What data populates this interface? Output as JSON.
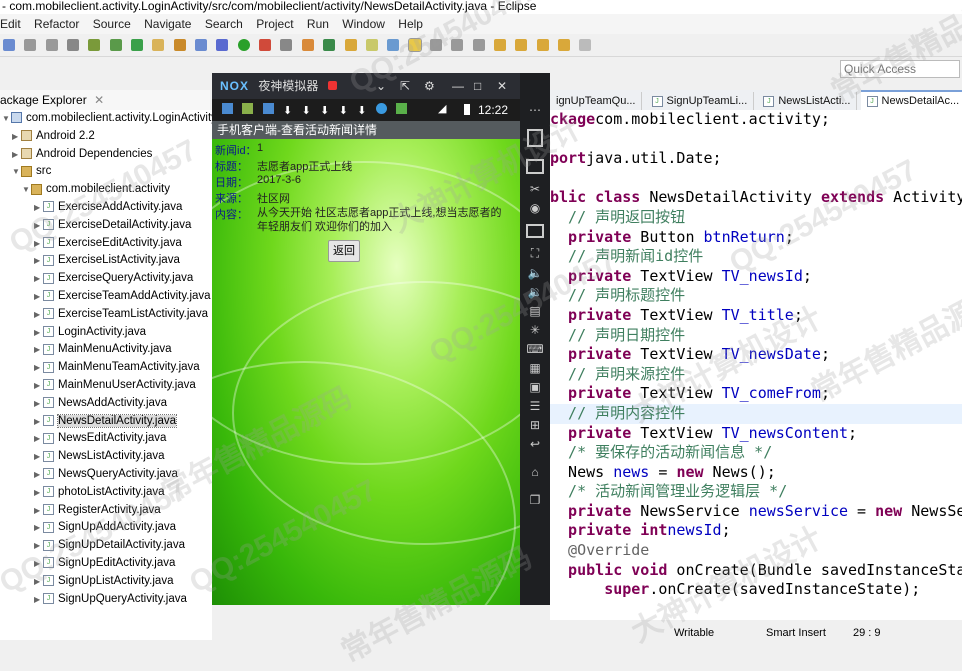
{
  "window": {
    "title": "- com.mobileclient.activity.LoginActivity/src/com/mobileclient/activity/NewsDetailActivity.java - Eclipse"
  },
  "menu": [
    "Edit",
    "Refactor",
    "Source",
    "Navigate",
    "Search",
    "Project",
    "Run",
    "Window",
    "Help"
  ],
  "quick_access": {
    "placeholder": "Quick Access"
  },
  "package_explorer": {
    "tab": "ackage Explorer",
    "project": "com.mobileclient.activity.LoginActivity",
    "nodes": [
      "Android 2.2",
      "Android Dependencies",
      "src"
    ],
    "package": "com.mobileclient.activity",
    "files": [
      "ExerciseAddActivity.java",
      "ExerciseDetailActivity.java",
      "ExerciseEditActivity.java",
      "ExerciseListActivity.java",
      "ExerciseQueryActivity.java",
      "ExerciseTeamAddActivity.java",
      "ExerciseTeamListActivity.java",
      "LoginActivity.java",
      "MainMenuActivity.java",
      "MainMenuTeamActivity.java",
      "MainMenuUserActivity.java",
      "NewsAddActivity.java",
      "NewsDetailActivity.java",
      "NewsEditActivity.java",
      "NewsListActivity.java",
      "NewsQueryActivity.java",
      "photoListActivity.java",
      "RegisterActivity.java",
      "SignUpAddActivity.java",
      "SignUpDetailActivity.java",
      "SignUpEditActivity.java",
      "SignUpListActivity.java",
      "SignUpQueryActivity.java"
    ],
    "selected_file": "NewsDetailActivity.java"
  },
  "editor": {
    "tabs": [
      "ignUpTeamQu...",
      "SignUpTeamLi...",
      "NewsListActi...",
      "NewsDetailAc..."
    ],
    "active_tab": "NewsDetailAc..."
  },
  "code_lines": [
    [
      [
        "kw",
        "ckage"
      ],
      [
        "",
        "com.mobileclient.activity;"
      ]
    ],
    [],
    [
      [
        "kw",
        "port"
      ],
      [
        "",
        "java.util.Date;"
      ]
    ],
    [],
    [
      [
        "kw",
        "blic class"
      ],
      [
        "",
        " NewsDetailActivity "
      ],
      [
        "kw",
        "extends"
      ],
      [
        "",
        " Activity"
      ]
    ],
    [
      [
        "cm",
        "  // 声明返回按钮"
      ]
    ],
    [
      [
        "kw",
        "  private"
      ],
      [
        "",
        " Button "
      ],
      [
        "fd",
        "btnReturn"
      ],
      [
        "",
        ";"
      ]
    ],
    [
      [
        "cm",
        "  // 声明新闻id控件"
      ]
    ],
    [
      [
        "kw",
        "  private"
      ],
      [
        "",
        " TextView "
      ],
      [
        "fd",
        "TV_newsId"
      ],
      [
        "",
        ";"
      ]
    ],
    [
      [
        "cm",
        "  // 声明标题控件"
      ]
    ],
    [
      [
        "kw",
        "  private"
      ],
      [
        "",
        " TextView "
      ],
      [
        "fd",
        "TV_title"
      ],
      [
        "",
        ";"
      ]
    ],
    [
      [
        "cm",
        "  // 声明日期控件"
      ]
    ],
    [
      [
        "kw",
        "  private"
      ],
      [
        "",
        " TextView "
      ],
      [
        "fd",
        "TV_newsDate"
      ],
      [
        "",
        ";"
      ]
    ],
    [
      [
        "cm",
        "  // 声明来源控件"
      ]
    ],
    [
      [
        "kw",
        "  private"
      ],
      [
        "",
        " TextView "
      ],
      [
        "fd",
        "TV_comeFrom"
      ],
      [
        "",
        ";"
      ]
    ],
    [
      [
        "cm",
        "  // 声明内容控件"
      ]
    ],
    [
      [
        "kw",
        "  private"
      ],
      [
        "",
        " TextView "
      ],
      [
        "fd",
        "TV_newsContent"
      ],
      [
        "",
        ";"
      ]
    ],
    [
      [
        "cm",
        "  /* 要保存的活动新闻信息 */"
      ]
    ],
    [
      [
        "",
        "  News "
      ],
      [
        "fd",
        "news"
      ],
      [
        "",
        " = "
      ],
      [
        "kw",
        "new"
      ],
      [
        "",
        " News();"
      ]
    ],
    [
      [
        "cm",
        "  /* 活动新闻管理业务逻辑层 */"
      ]
    ],
    [
      [
        "kw",
        "  private"
      ],
      [
        "",
        " NewsService "
      ],
      [
        "fd",
        "newsService"
      ],
      [
        "",
        " = "
      ],
      [
        "kw",
        "new"
      ],
      [
        "",
        " NewsSe"
      ]
    ],
    [
      [
        "kw",
        "  private int"
      ],
      [
        " ",
        ""
      ],
      [
        "fd",
        "newsId"
      ],
      [
        "",
        ";"
      ]
    ],
    [
      [
        "an",
        "  @Override"
      ]
    ],
    [
      [
        "kw",
        "  public void"
      ],
      [
        "",
        " onCreate(Bundle savedInstanceSta"
      ]
    ],
    [
      [
        "",
        "      "
      ],
      [
        "kw",
        "super"
      ],
      [
        "",
        ".onCreate(savedInstanceState);"
      ]
    ]
  ],
  "highlighted_line": 15,
  "status": {
    "writable": "Writable",
    "insert_mode": "Smart Insert",
    "position": "29 : 9"
  },
  "emulator": {
    "title": "夜神模拟器",
    "clock": "12:22",
    "app_title": "手机客户端-查看活动新闻详情",
    "fields": [
      {
        "label": "新闻id：",
        "value": "1"
      },
      {
        "label": "标题：",
        "value": "志愿者app正式上线"
      },
      {
        "label": "日期：",
        "value": "2017-3-6"
      },
      {
        "label": "来源：",
        "value": "社区网"
      },
      {
        "label": "内容：",
        "value": "从今天开始 社区志愿者app正式上线,想当志愿者的年轻朋友们 欢迎你们的加入"
      }
    ],
    "back_button": "返回"
  },
  "watermarks": [
    "QQ:254540457",
    "常年售精品源码",
    "大神计算机设计"
  ],
  "colors": {
    "keyword": "#7f0055",
    "comment": "#3f7f5f",
    "field": "#0000c0",
    "emu_dark": "#2b2d33",
    "screen_green": "#6fd81c"
  }
}
